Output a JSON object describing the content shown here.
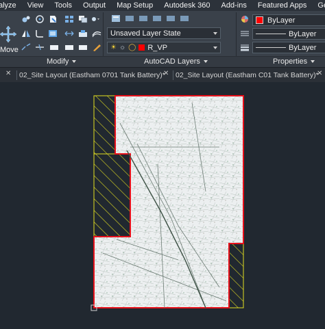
{
  "menu": [
    "alyze",
    "View",
    "Tools",
    "Output",
    "Map Setup",
    "Autodesk 360",
    "Add-ins",
    "Featured Apps",
    "Geolocation"
  ],
  "ribbon": {
    "move_label": "Move",
    "panels": {
      "modify": "Modify",
      "layers": "AutoCAD Layers",
      "properties": "Properties"
    },
    "layer_state": "Unsaved Layer State",
    "current_layer": "R_VP",
    "color": "ByLayer",
    "linetype": "ByLayer",
    "lineweight": "ByLayer",
    "layer_color": "#ff0000"
  },
  "tabs": [
    "02_Site Layout (Eastham 0701 Tank Battery)*",
    "02_Site Layout (Eastham C01 Tank Battery)*"
  ],
  "colors": {
    "background": "#212830",
    "viewport_border": "#e8101a",
    "hatch": "#e4e020"
  }
}
